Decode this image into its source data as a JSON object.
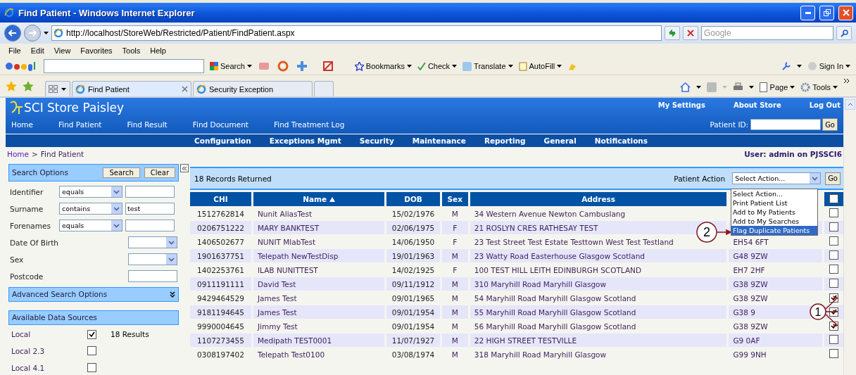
{
  "window": {
    "title": "Find Patient - Windows Internet Explorer"
  },
  "browser": {
    "address": "http://localhost/StoreWeb/Restricted/Patient/FindPatient.aspx",
    "search_placeholder": "Google",
    "menu": [
      "File",
      "Edit",
      "View",
      "Favorites",
      "Tools",
      "Help"
    ],
    "google_toolbar": [
      "Search",
      "Bookmarks",
      "Check",
      "Translate",
      "AutoFill"
    ],
    "sign_in": "Sign In",
    "tabs": [
      {
        "label": "Find Patient",
        "selected": true
      },
      {
        "label": "Security Exception",
        "selected": false
      }
    ],
    "command_bar": [
      "Page",
      "Tools"
    ]
  },
  "site": {
    "title": "SCI Store Paisley",
    "top_links": [
      "My Settings",
      "About Store",
      "Log Out"
    ],
    "patient_id_label": "Patient ID:",
    "go": "Go",
    "main_nav": [
      "Home",
      "Find Patient",
      "Find Result",
      "Find Document",
      "Find Treatment Log"
    ],
    "admin_nav": [
      "Configuration",
      "Exceptions Mgmt",
      "Security",
      "Maintenance",
      "Reporting",
      "General",
      "Notifications"
    ],
    "breadcrumb": [
      "Home",
      "Find Patient"
    ],
    "breadcrumb_separator": ">",
    "user": "User: admin on PJSSCI6"
  },
  "search_panel": {
    "title": "Search Options",
    "buttons": [
      "Search",
      "Clear"
    ],
    "fields": [
      {
        "label": "Identifier",
        "kind": "operator",
        "operator": "equals"
      },
      {
        "label": "Surname",
        "kind": "operator",
        "operator": "contains",
        "value": "test"
      },
      {
        "label": "Forenames",
        "kind": "operator",
        "operator": "equals"
      },
      {
        "label": "Date Of Birth",
        "kind": "select"
      },
      {
        "label": "Sex",
        "kind": "select"
      },
      {
        "label": "Postcode",
        "kind": "text"
      }
    ],
    "advanced": "Advanced Search Options",
    "expanded": false,
    "sources_title": "Available Data Sources",
    "sources": [
      {
        "name": "Local",
        "checked": true,
        "results": "18 Results"
      },
      {
        "name": "Local 2.3",
        "checked": false
      },
      {
        "name": "Local 4.1",
        "checked": false
      }
    ]
  },
  "results": {
    "count": "18 Records Returned",
    "action_label": "Patient Action",
    "action_value": "Select Action...",
    "go": "Go",
    "dropdown": [
      {
        "label": "Select Action...",
        "selected": false
      },
      {
        "label": "Print Patient List",
        "selected": false
      },
      {
        "label": "Add to My Patients",
        "selected": false
      },
      {
        "label": "Add to My Searches",
        "selected": false
      },
      {
        "label": "Flag Duplicate Patients",
        "selected": true
      }
    ],
    "columns": [
      {
        "label": "CHI",
        "sorted": false
      },
      {
        "label": "Name",
        "sorted": true
      },
      {
        "label": "DOB",
        "sorted": false
      },
      {
        "label": "Sex",
        "sorted": false
      },
      {
        "label": "Address",
        "sorted": false
      }
    ],
    "select_all": false,
    "rows": [
      {
        "chi": "1512762814",
        "name": "Nunit AliasTest",
        "dob": "15/02/1976",
        "sex": "M",
        "address": "34 Western Avenue Newton Cambuslang",
        "checked": false
      },
      {
        "chi": "0206751222",
        "name": "MARY BANKTEST",
        "dob": "02/06/1975",
        "sex": "F",
        "address": "21 ROSLYN CRES RATHESAY TEST",
        "checked": false
      },
      {
        "chi": "1406502677",
        "name": "NUNIT MlabTest",
        "dob": "14/06/1950",
        "sex": "F",
        "address": "23 Test Street Test Estate Testtown West Test Testland",
        "postcode": "EH54 6FT",
        "checked": false
      },
      {
        "chi": "1901637751",
        "name": "Telepath NewTestDisp",
        "dob": "19/01/1963",
        "sex": "M",
        "address": "23 Watty Road Easterhouse Glasgow Scotland",
        "postcode": "G48 9ZW",
        "checked": false
      },
      {
        "chi": "1402253761",
        "name": "ILAB NUNITTEST",
        "dob": "14/02/1925",
        "sex": "F",
        "address": "100 TEST HILL LEITH EDINBURGH SCOTLAND",
        "postcode": "EH7 2HF",
        "checked": false
      },
      {
        "chi": "0911191111",
        "name": "David Test",
        "dob": "09/11/1912",
        "sex": "M",
        "address": "310 Maryhill Road Maryhill Glasgow",
        "postcode": "G38 9ZW",
        "checked": false
      },
      {
        "chi": "9429464529",
        "name": "James Test",
        "dob": "09/01/1965",
        "sex": "M",
        "address": "54 Maryhill Road Maryhill Glasgow Scotland",
        "postcode": "G38 9ZW",
        "checked": true
      },
      {
        "chi": "9181194645",
        "name": "James Test",
        "dob": "09/01/1954",
        "sex": "M",
        "address": "55 Maryhill Road Maryhill Glasgow Scotland",
        "postcode": "G38 9",
        "checked": true
      },
      {
        "chi": "9990004645",
        "name": "Jimmy Test",
        "dob": "09/01/1954",
        "sex": "M",
        "address": "56 Maryhill Road Maryhill Glasgow Scotland",
        "postcode": "G38 9ZW",
        "checked": true
      },
      {
        "chi": "1107273455",
        "name": "Medipath TEST0001",
        "dob": "11/07/1927",
        "sex": "M",
        "address": "22 HIGH STREET TESTVILLE",
        "postcode": "G9 0AF",
        "checked": false
      },
      {
        "chi": "0308197402",
        "name": "Telepath Test0100",
        "dob": "03/08/1974",
        "sex": "M",
        "address": "318 Maryhill Road Maryhill Glasgow",
        "postcode": "G99 9NH",
        "checked": false
      }
    ]
  },
  "callouts": [
    {
      "label": "1"
    },
    {
      "label": "2"
    }
  ]
}
